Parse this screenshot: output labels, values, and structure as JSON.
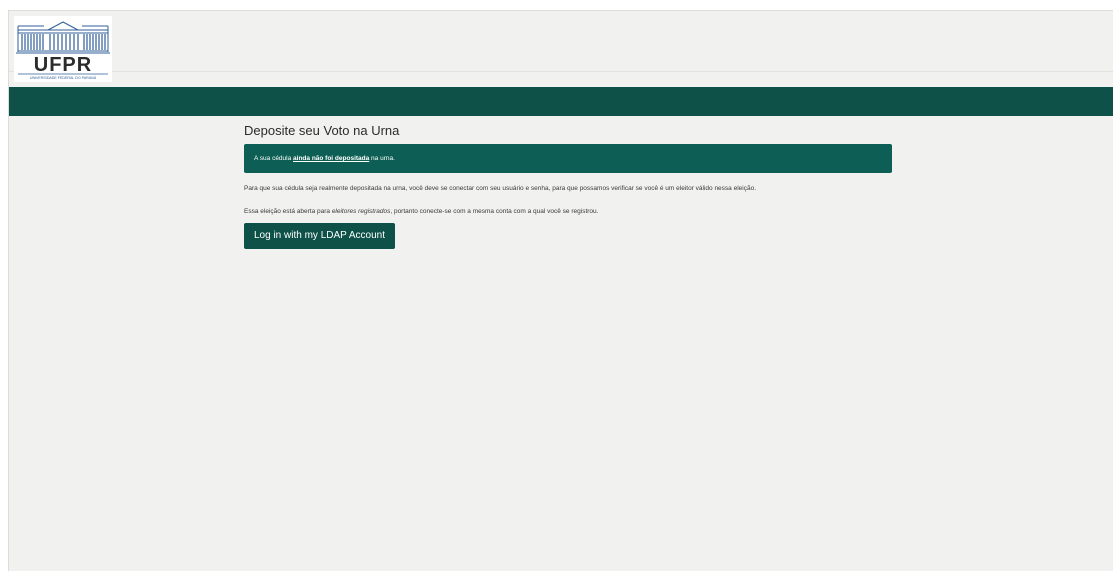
{
  "header": {
    "logo": {
      "wordmark": "UFPR",
      "subtitle": "UNIVERSIDADE FEDERAL DO PARANÁ"
    }
  },
  "main": {
    "title": "Deposite seu Voto na Urna",
    "alert": {
      "prefix": "A sua cédula ",
      "emphasis": "ainda não foi depositada",
      "suffix": " na urna."
    },
    "paragraph1": "Para que sua cédula seja realmente depositada na urna, você deve se conectar com seu usuário e senha, para que possamos verificar se você é um eleitor válido nessa eleição.",
    "paragraph2": {
      "prefix": "Essa eleição está aberta para ",
      "italic": "eleitores registrados",
      "suffix": ", portanto conecte-se com a mesma conta com a qual você se registrou."
    },
    "login_button": "Log in with my LDAP Account"
  },
  "colors": {
    "primary": "#0d5148",
    "alert_bg": "#0d5f55",
    "page_bg": "#f1f1ef",
    "logo_blue": "#2f5f9a"
  }
}
